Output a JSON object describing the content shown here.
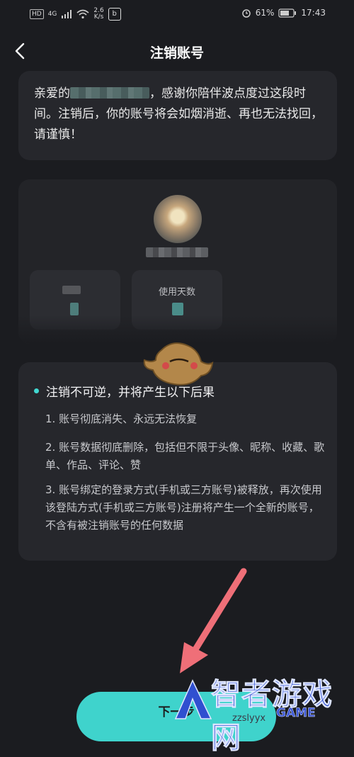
{
  "status_bar": {
    "network_hd": "HD",
    "network_gen": "4G",
    "speed_value": "2.6",
    "speed_unit": "K/s",
    "battery": "61%",
    "time": "17:43"
  },
  "navbar": {
    "title": "注销账号"
  },
  "greeting": {
    "prefix": "亲爱的",
    "suffix": "，感谢你陪伴波点度过这段时间。注销后，你的账号将会如烟消逝、再也无法找回，请谨慎！"
  },
  "profile": {
    "stats": [
      {
        "label": "",
        "value": ""
      },
      {
        "label": "使用天数",
        "value": ""
      }
    ]
  },
  "warning": {
    "title": "注销不可逆，并将产生以下后果",
    "items": [
      "1. 账号彻底消失、永远无法恢复",
      "2. 账号数据彻底删除，包括但不限于头像、昵称、收藏、歌单、作品、评论、赞",
      "3. 账号绑定的登录方式(手机或三方账号)被释放，再次使用该登陆方式(手机或三方账号)注册将产生一个全新的账号，不含有被注销账号的任何数据"
    ]
  },
  "actions": {
    "next_label": "下一步"
  },
  "watermark": {
    "cn": "智者游戏网",
    "en": "GAME",
    "site": "zzslyyx"
  },
  "colors": {
    "accent": "#3fd3cc",
    "background": "#1b1c20",
    "card": "#26272c",
    "arrow": "#ef6f78"
  }
}
